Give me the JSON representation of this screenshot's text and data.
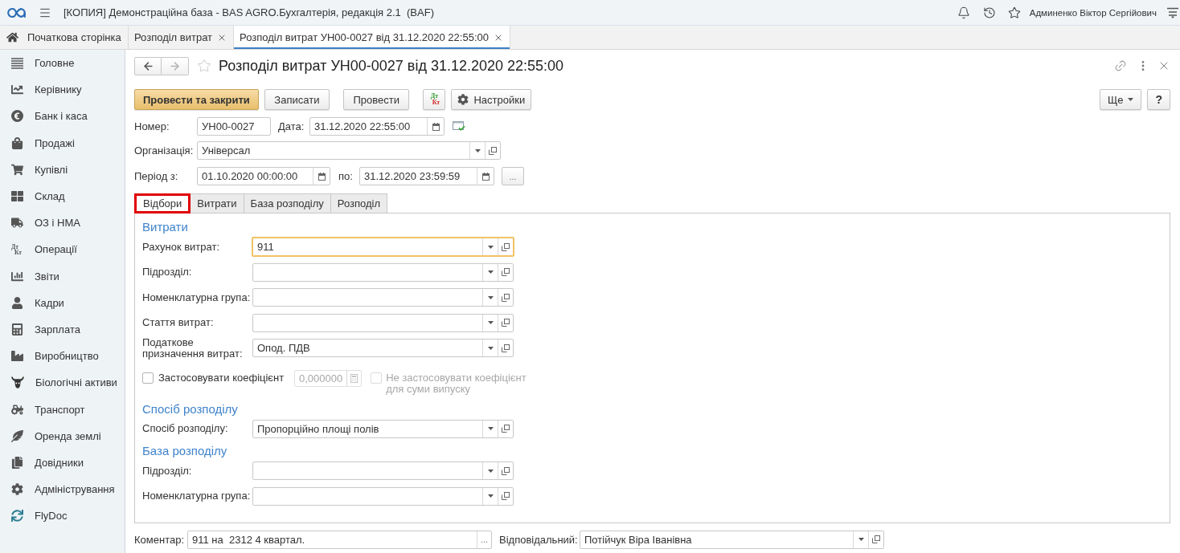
{
  "app_bar": {
    "title": "[КОПИЯ] Демонстраційна база - BAS AGRO.Бухгалтерія, редакція 2.1  (BAF)",
    "user": "Админенко Віктор Сергійович"
  },
  "open_tabs": [
    {
      "kind": "home",
      "label": "Початкова сторінка",
      "selected": false
    },
    {
      "kind": "document",
      "label": "Розподіл витрат",
      "selected": false
    },
    {
      "kind": "document",
      "label": "Розподіл витрат УН00-0027 від 31.12.2020 22:55:00",
      "selected": true
    }
  ],
  "sidebar": {
    "items": [
      {
        "label": "Головне"
      },
      {
        "label": "Керівнику"
      },
      {
        "label": "Банк і каса"
      },
      {
        "label": "Продажі"
      },
      {
        "label": "Купівлі"
      },
      {
        "label": "Склад"
      },
      {
        "label": "ОЗ і НМА"
      },
      {
        "label": "Операції",
        "icon_letters": [
          "Дт",
          "Кт"
        ]
      },
      {
        "label": "Звіти"
      },
      {
        "label": "Кадри"
      },
      {
        "label": "Зарплата"
      },
      {
        "label": "Виробництво"
      },
      {
        "label": "Біологічні активи"
      },
      {
        "label": "Транспорт"
      },
      {
        "label": "Оренда землі"
      },
      {
        "label": "Довідники"
      },
      {
        "label": "Адміністрування"
      },
      {
        "label": "FlyDoc"
      }
    ]
  },
  "document": {
    "title": "Розподіл витрат УН00-0027 від 31.12.2020 22:55:00",
    "favorite": false,
    "back_disabled": false,
    "forward_disabled": true
  },
  "toolbar": {
    "groups": [
      [
        {
          "kind": "primary",
          "label": "Провести та закрити"
        },
        {
          "kind": "default",
          "label": "Записати"
        }
      ],
      [
        {
          "kind": "default",
          "label": "Провести"
        }
      ],
      [
        {
          "kind": "postings",
          "icon_letters": [
            "Дт",
            "Кт"
          ]
        },
        {
          "kind": "settings",
          "label": "Настройки"
        }
      ]
    ],
    "more": "Ще",
    "help": "?"
  },
  "header": {
    "number": {
      "label": "Номер:",
      "value": "УН00-0027"
    },
    "date": {
      "label": "Дата:",
      "value": "31.12.2020 22:55:00"
    },
    "organization": {
      "label": "Організація:",
      "value": "Універсал"
    },
    "period": {
      "label": "Період з:",
      "from": "01.10.2020 00:00:00",
      "to_label": "по:",
      "to": "31.12.2020 23:59:59",
      "button": "..."
    }
  },
  "form_tabs": [
    {
      "label": "Відбори",
      "selected": true,
      "highlighted": true
    },
    {
      "label": "Витрати",
      "selected": false,
      "highlighted": false
    },
    {
      "label": "База розподілу",
      "selected": false,
      "highlighted": false
    },
    {
      "label": "Розподіл",
      "selected": false,
      "highlighted": false
    }
  ],
  "sections": [
    {
      "heading": "Витрати",
      "rows": [
        {
          "kind": "select",
          "label": "Рахунок витрат:",
          "value": "911",
          "focused": true
        },
        {
          "kind": "select",
          "label": "Підрозділ:",
          "focused": false
        },
        {
          "kind": "select",
          "label": "Номенклатурна група:",
          "focused": false
        },
        {
          "kind": "select",
          "label": "Стаття витрат:",
          "focused": false
        },
        {
          "kind": "select",
          "label": "Податкове призначення витрат:",
          "value": "Опод. ПДВ",
          "focused": false
        },
        {
          "kind": "coefficient",
          "label": "Застосовувати коефіцієнт",
          "checked": false,
          "value": "0,000000",
          "disabled": true,
          "option": {
            "label": "Не застосовувати коефіцієнт для суми випуску",
            "checked": false,
            "disabled": true
          }
        }
      ]
    },
    {
      "heading": "Спосіб розподілу",
      "rows": [
        {
          "kind": "select",
          "label": "Спосіб розподілу:",
          "value": "Пропорційно площі полів",
          "focused": false
        }
      ]
    },
    {
      "heading": "База розподілу",
      "rows": [
        {
          "kind": "select",
          "label": "Підрозділ:",
          "focused": false
        },
        {
          "kind": "select",
          "label": "Номенклатурна група:",
          "focused": false
        }
      ]
    }
  ],
  "footer": {
    "comment": {
      "label": "Коментар:",
      "value": "911 на  2312 4 квартал.",
      "button": "..."
    },
    "responsible": {
      "label": "Відповідальний:",
      "value": "Потійчук Віра Іванівна"
    }
  }
}
